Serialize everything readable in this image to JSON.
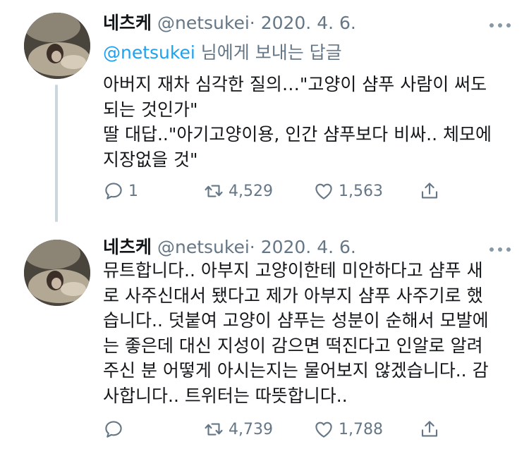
{
  "tweets": [
    {
      "display_name": "네츠케",
      "handle": "@netsukei",
      "separator": "·",
      "date": "2020. 4. 6.",
      "reply_mention": "@netsukei",
      "reply_suffix": " 님에게 보내는 답글",
      "text": "아버지 재차 심각한 질의…\"고양이 샴푸 사람이 써도\n되는 것인가\"\n딸 대답..\"아기고양이용, 인간 샴푸보다 비싸.. 체모에\n지장없을 것\"",
      "stats": {
        "replies": "1",
        "retweets": "4,529",
        "likes": "1,563"
      }
    },
    {
      "display_name": "네츠케",
      "handle": "@netsukei",
      "separator": "·",
      "date": "2020. 4. 6.",
      "text": "뮤트합니다.. 아부지 고양이한테 미안하다고 샴푸 새\n로 사주신대서 됐다고 제가 아부지 샴푸 사주기로 했\n습니다.. 덧붙여 고양이 샴푸는 성분이 순해서 모발에\n는 좋은데 대신 지성이 감으면 떡진다고 인알로 알려\n주신 분 어떻게 아시는지는 물어보지 않겠습니다.. 감\n사합니다.. 트위터는 따뜻합니다..",
      "stats": {
        "replies": "",
        "retweets": "4,739",
        "likes": "1,788"
      }
    }
  ],
  "icons": {
    "reply": "reply-icon",
    "retweet": "retweet-icon",
    "like": "heart-icon",
    "share": "share-icon",
    "more": "more-icon"
  },
  "colors": {
    "text": "#14171a",
    "secondary": "#657786",
    "link": "#1da1f2",
    "thread_line": "#ccd6dd"
  }
}
